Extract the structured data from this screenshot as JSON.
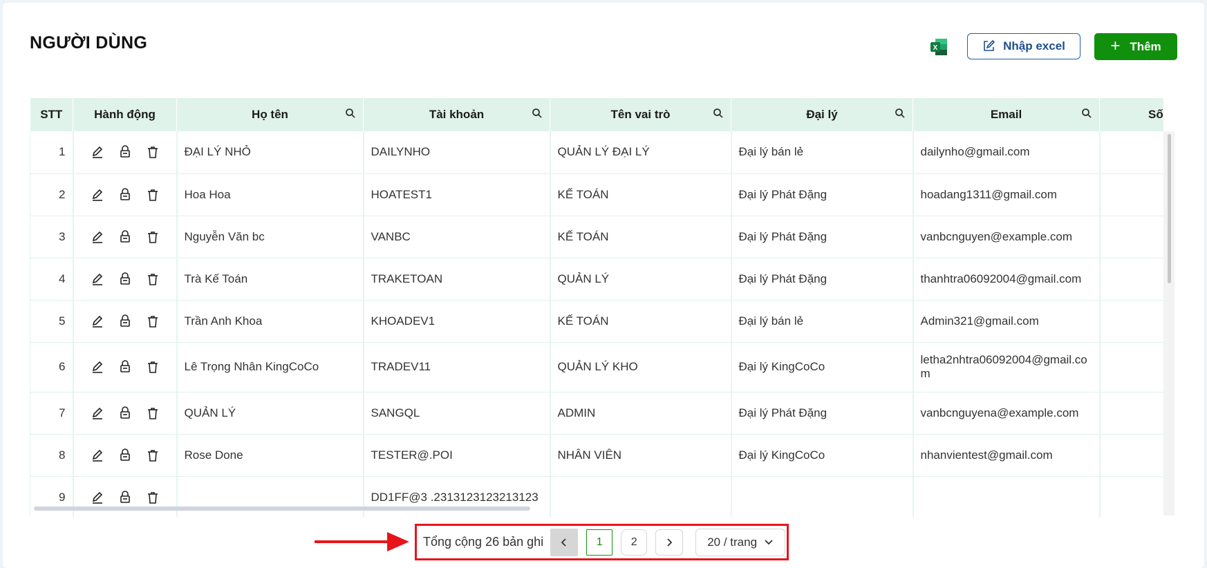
{
  "page": {
    "title": "NGƯỜI DÙNG"
  },
  "toolbar": {
    "excel_icon": "excel-icon",
    "import_label": "Nhập excel",
    "add_label": "Thêm",
    "accent": "#10900d",
    "import_color": "#1f5fa8"
  },
  "table": {
    "columns": [
      "STT",
      "Hành động",
      "Họ tên",
      "Tài khoản",
      "Tên vai trò",
      "Đại lý",
      "Email",
      "Số đi"
    ],
    "rows": [
      {
        "stt": "1",
        "name": "ĐẠI LÝ NHỎ",
        "account": "DAILYNHO",
        "role": "QUẢN LÝ ĐẠI LÝ",
        "agency": "Đại lý bán lẻ",
        "email": "dailynho@gmail.com"
      },
      {
        "stt": "2",
        "name": "Hoa Hoa",
        "account": "HOATEST1",
        "role": "KẾ TOÁN",
        "agency": "Đại lý Phát Đặng",
        "email": "hoadang1311@gmail.com"
      },
      {
        "stt": "3",
        "name": "Nguyễn Văn bc",
        "account": "VANBC",
        "role": "KẾ TOÁN",
        "agency": "Đại lý Phát Đặng",
        "email": "vanbcnguyen@example.com"
      },
      {
        "stt": "4",
        "name": "Trà Kế Toán",
        "account": "TRAKETOAN",
        "role": "QUẢN LÝ",
        "agency": "Đại lý Phát Đặng",
        "email": "thanhtra06092004@gmail.com"
      },
      {
        "stt": "5",
        "name": "Trần Anh Khoa",
        "account": "KHOADEV1",
        "role": "KẾ TOÁN",
        "agency": "Đại lý bán lẻ",
        "email": "Admin321@gmail.com"
      },
      {
        "stt": "6",
        "name": "Lê Trọng Nhân KingCoCo",
        "account": "TRADEV11",
        "role": "QUẢN LÝ KHO",
        "agency": "Đại lý KingCoCo",
        "email": "letha2nhtra06092004@gmail.com"
      },
      {
        "stt": "7",
        "name": "QUẢN LÝ",
        "account": "SANGQL",
        "role": "ADMIN",
        "agency": "Đại lý Phát Đặng",
        "email": "vanbcnguyena@example.com"
      },
      {
        "stt": "8",
        "name": "Rose Done",
        "account": "TESTER@.POI",
        "role": "NHÂN VIÊN",
        "agency": "Đại lý KingCoCo",
        "email": "nhanvientest@gmail.com"
      },
      {
        "stt": "9",
        "name": "",
        "account": "DD1FF@3 .2313123123213123",
        "role": "",
        "agency": "",
        "email": ""
      }
    ]
  },
  "pagination": {
    "total_text": "Tổng cộng 26 bản ghi",
    "pages": [
      "1",
      "2"
    ],
    "current_page": "1",
    "page_size": "20 / trang"
  }
}
